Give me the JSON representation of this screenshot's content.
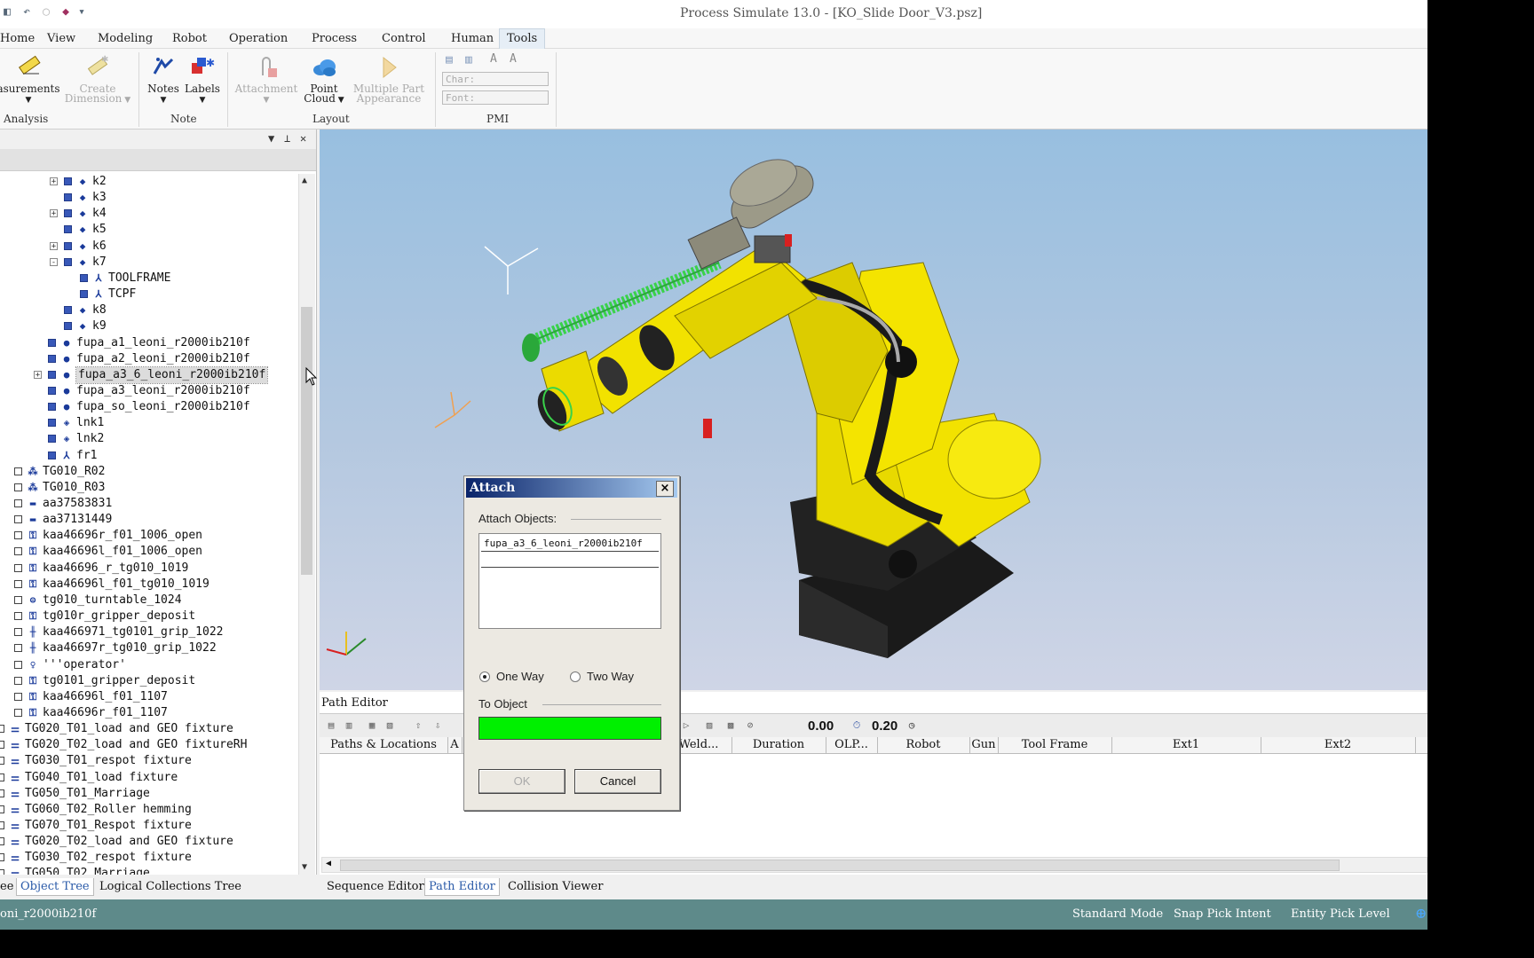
{
  "window": {
    "title": "Process Simulate 13.0 - [KO_Slide Door_V3.psz]"
  },
  "menu": [
    "Home",
    "View",
    "Modeling",
    "Robot",
    "Operation",
    "Process",
    "Control",
    "Human",
    "Tools"
  ],
  "ribbon": {
    "measurements": "asurements",
    "create_dimension_1": "Create",
    "create_dimension_2": "Dimension",
    "group_analysis": "Analysis",
    "notes": "Notes",
    "labels": "Labels",
    "group_note": "Note",
    "attachment": "Attachment",
    "point_cloud_1": "Point",
    "point_cloud_2": "Cloud",
    "multiple_part_1": "Multiple Part",
    "multiple_part_2": "Appearance",
    "group_layout": "Layout",
    "char_placeholder": "Char:",
    "font_placeholder": "Font:",
    "group_pmi": "PMI"
  },
  "tree": {
    "rows": [
      {
        "label": "k2",
        "exp": "+",
        "icon": "diamond"
      },
      {
        "label": "k3",
        "exp": "",
        "icon": "diamond"
      },
      {
        "label": "k4",
        "exp": "+",
        "icon": "diamond"
      },
      {
        "label": "k5",
        "exp": "",
        "icon": "diamond"
      },
      {
        "label": "k6",
        "exp": "+",
        "icon": "diamond"
      },
      {
        "label": "k7",
        "exp": "-",
        "icon": "diamond"
      },
      {
        "label": "TOOLFRAME",
        "exp": "",
        "icon": "frame"
      },
      {
        "label": "TCPF",
        "exp": "",
        "icon": "frame"
      },
      {
        "label": "k8",
        "exp": "",
        "icon": "diamond"
      },
      {
        "label": "k9",
        "exp": "",
        "icon": "diamond"
      },
      {
        "label": "fupa_a1_leoni_r2000ib210f",
        "exp": "",
        "icon": "dot"
      },
      {
        "label": "fupa_a2_leoni_r2000ib210f",
        "exp": "",
        "icon": "dot"
      },
      {
        "label": "fupa_a3_6_leoni_r2000ib210f",
        "exp": "+",
        "icon": "dot"
      },
      {
        "label": "fupa_a3_leoni_r2000ib210f",
        "exp": "",
        "icon": "dot"
      },
      {
        "label": "fupa_so_leoni_r2000ib210f",
        "exp": "",
        "icon": "dot"
      },
      {
        "label": "lnk1",
        "exp": "",
        "icon": "link"
      },
      {
        "label": "lnk2",
        "exp": "",
        "icon": "link"
      },
      {
        "label": "fr1",
        "exp": "",
        "icon": "frame"
      },
      {
        "label": "TG010_R02",
        "exp": "",
        "icon": "robot"
      },
      {
        "label": "TG010_R03",
        "exp": "",
        "icon": "robot"
      },
      {
        "label": "aa37583831",
        "exp": "",
        "icon": "block"
      },
      {
        "label": "aa37131449",
        "exp": "",
        "icon": "block"
      },
      {
        "label": "kaa46696r_f01_1006_open",
        "exp": "",
        "icon": "tool"
      },
      {
        "label": "kaa46696l_f01_1006_open",
        "exp": "",
        "icon": "tool"
      },
      {
        "label": "kaa46696_r_tg010_1019",
        "exp": "",
        "icon": "tool"
      },
      {
        "label": "kaa46696l_f01_tg010_1019",
        "exp": "",
        "icon": "tool"
      },
      {
        "label": "tg010_turntable_1024",
        "exp": "",
        "icon": "turntable"
      },
      {
        "label": "tg010r_gripper_deposit",
        "exp": "",
        "icon": "tool"
      },
      {
        "label": "kaa466971_tg0101_grip_1022",
        "exp": "",
        "icon": "grip"
      },
      {
        "label": "kaa46697r_tg010_grip_1022",
        "exp": "",
        "icon": "grip"
      },
      {
        "label": "'''operator'",
        "exp": "",
        "icon": "human"
      },
      {
        "label": "tg0101_gripper_deposit",
        "exp": "",
        "icon": "tool"
      },
      {
        "label": "kaa46696l_f01_1107",
        "exp": "",
        "icon": "tool"
      },
      {
        "label": "kaa46696r_f01_1107",
        "exp": "",
        "icon": "tool"
      },
      {
        "label": "TG020_T01_load and GEO fixture",
        "exp": "",
        "icon": "fixture"
      },
      {
        "label": "TG020_T02_load and GEO fixtureRH",
        "exp": "",
        "icon": "fixture"
      },
      {
        "label": "TG030_T01_respot fixture",
        "exp": "",
        "icon": "fixture"
      },
      {
        "label": "TG040_T01_load fixture",
        "exp": "",
        "icon": "fixture"
      },
      {
        "label": "TG050_T01_Marriage",
        "exp": "",
        "icon": "fixture"
      },
      {
        "label": "TG060_T02_Roller hemming",
        "exp": "",
        "icon": "fixture"
      },
      {
        "label": "TG070_T01_Respot fixture",
        "exp": "",
        "icon": "fixture"
      },
      {
        "label": "TG020_T02_load and GEO fixture",
        "exp": "",
        "icon": "fixture"
      },
      {
        "label": "TG030_T02_respot fixture",
        "exp": "",
        "icon": "fixture"
      },
      {
        "label": "TG050 T02 Marriage",
        "exp": "",
        "icon": "fixture"
      }
    ],
    "selected_index": 12
  },
  "panel_tabs": [
    "ee",
    "Object Tree",
    "Logical Collections Tree"
  ],
  "path_editor": {
    "title": "Path Editor",
    "value1": "0.00",
    "value2": "0.20",
    "columns": [
      "Paths & Locations",
      "A",
      "...",
      "Weld...",
      "Duration",
      "OLP...",
      "Robot",
      "Gun",
      "Tool Frame",
      "Ext1",
      "Ext2"
    ]
  },
  "bottom_tabs": [
    "Sequence Editor",
    "Path Editor",
    "Collision Viewer"
  ],
  "status": {
    "left": "oni_r2000ib210f",
    "mode": "Standard Mode",
    "snap": "Snap Pick Intent",
    "entity": "Entity Pick Level"
  },
  "dialog": {
    "title": "Attach",
    "attach_objects_label": "Attach Objects:",
    "object": "fupa_a3_6_leoni_r2000ib210f",
    "one_way": "One Way",
    "two_way": "Two Way",
    "to_object_label": "To Object",
    "ok": "OK",
    "cancel": "Cancel",
    "close": "×",
    "to_object_color": "#00f000"
  },
  "colors": {
    "robot_yellow": "#f2e200",
    "cable_green": "#39d24a",
    "status_bar": "#5e8a8a"
  }
}
